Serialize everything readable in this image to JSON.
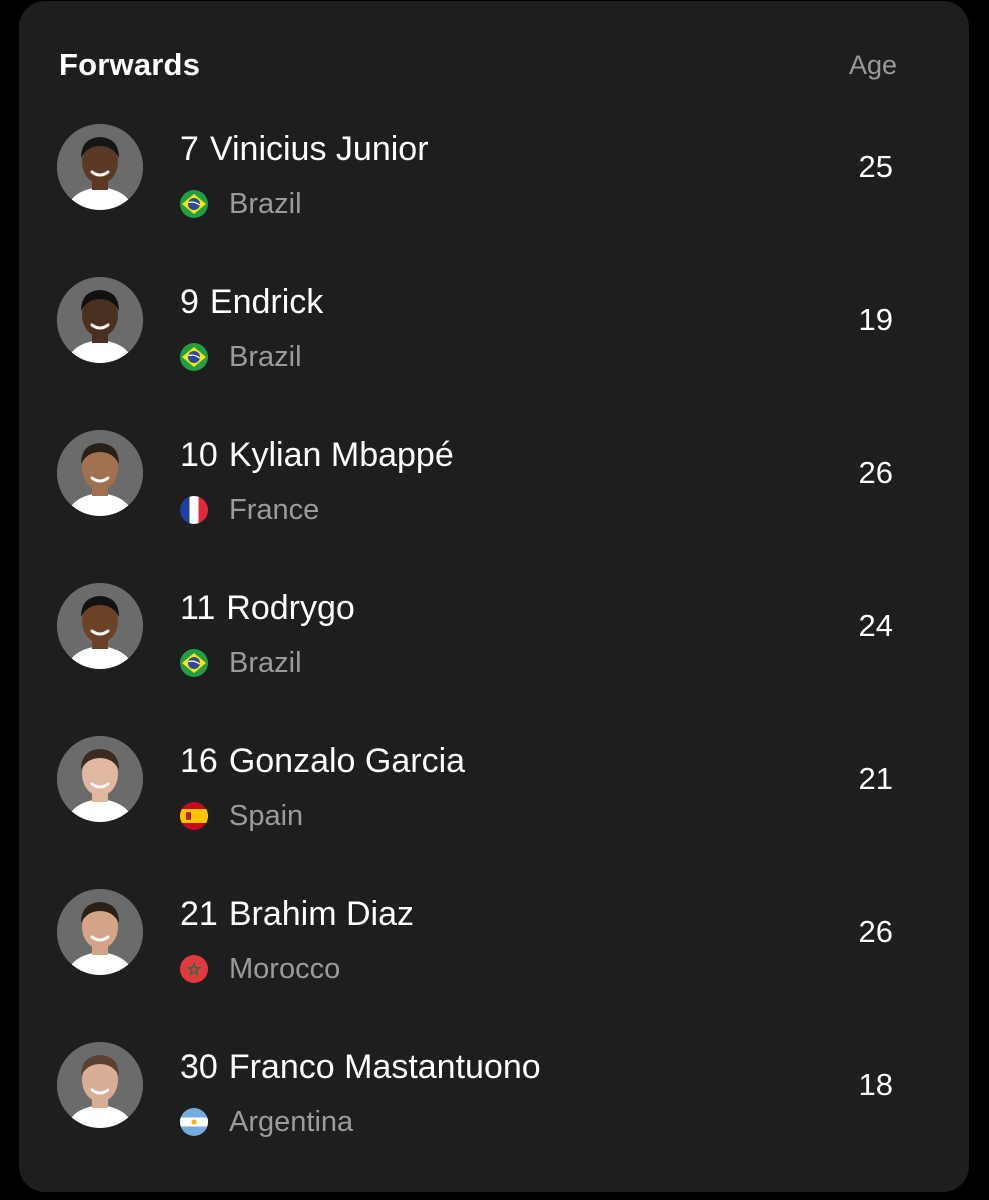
{
  "header": {
    "title": "Forwards",
    "age_label": "Age"
  },
  "players": [
    {
      "number": "7",
      "name": "Vinicius Junior",
      "nation": "Brazil",
      "flag": "brazil-flag-icon",
      "age": "25",
      "skin": "#5a3a26",
      "hair": "#151515"
    },
    {
      "number": "9",
      "name": "Endrick",
      "nation": "Brazil",
      "flag": "brazil-flag-icon",
      "age": "19",
      "skin": "#4a3020",
      "hair": "#101010"
    },
    {
      "number": "10",
      "name": "Kylian Mbappé",
      "nation": "France",
      "flag": "france-flag-icon",
      "age": "26",
      "skin": "#a07050",
      "hair": "#2a2018"
    },
    {
      "number": "11",
      "name": "Rodrygo",
      "nation": "Brazil",
      "flag": "brazil-flag-icon",
      "age": "24",
      "skin": "#6b4228",
      "hair": "#121212"
    },
    {
      "number": "16",
      "name": "Gonzalo Garcia",
      "nation": "Spain",
      "flag": "spain-flag-icon",
      "age": "21",
      "skin": "#e0b8a0",
      "hair": "#3a2a20"
    },
    {
      "number": "21",
      "name": "Brahim Diaz",
      "nation": "Morocco",
      "flag": "morocco-flag-icon",
      "age": "26",
      "skin": "#d4a488",
      "hair": "#2a2018"
    },
    {
      "number": "30",
      "name": "Franco Mastantuono",
      "nation": "Argentina",
      "flag": "argentina-flag-icon",
      "age": "18",
      "skin": "#d8ae96",
      "hair": "#5a4030"
    }
  ],
  "colors": {
    "background": "#000000",
    "card": "#1e1e1e",
    "text_primary": "#ffffff",
    "text_secondary": "#9b9b9b",
    "avatar_bg": "#6b6b6b"
  }
}
